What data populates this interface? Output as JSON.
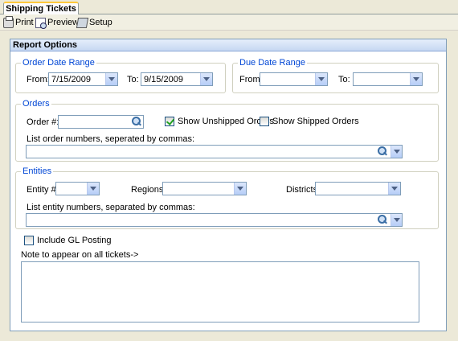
{
  "tab": {
    "label": "Shipping Tickets"
  },
  "toolbar": {
    "print": "Print",
    "preview": "Preview",
    "setup": "Setup"
  },
  "panel": {
    "title": "Report Options"
  },
  "order_date_range": {
    "legend": "Order Date Range",
    "from_label": "From:",
    "from_value": "7/15/2009",
    "to_label": "To:",
    "to_value": "9/15/2009"
  },
  "due_date_range": {
    "legend": "Due Date Range",
    "from_label": "From:",
    "from_value": "",
    "to_label": "To:",
    "to_value": ""
  },
  "orders": {
    "legend": "Orders",
    "order_label": "Order #:",
    "order_value": "",
    "show_unshipped_label": "Show Unshipped Orders",
    "show_unshipped_checked": true,
    "show_shipped_label": "Show Shipped Orders",
    "show_shipped_checked": false,
    "list_label": "List order numbers, seperated by commas:",
    "list_value": ""
  },
  "entities": {
    "legend": "Entities",
    "entity_label": "Entity #:",
    "entity_value": "",
    "regions_label": "Regions:",
    "regions_value": "",
    "districts_label": "Districts:",
    "districts_value": "",
    "list_label": "List entity numbers, separated by commas:",
    "list_value": ""
  },
  "include_gl": {
    "label": "Include GL Posting",
    "checked": false
  },
  "note": {
    "label": "Note to appear on all tickets->",
    "value": ""
  },
  "colors": {
    "legend_text": "#0046d5",
    "border": "#7f9db9",
    "tab_accent": "#ffc83c"
  }
}
